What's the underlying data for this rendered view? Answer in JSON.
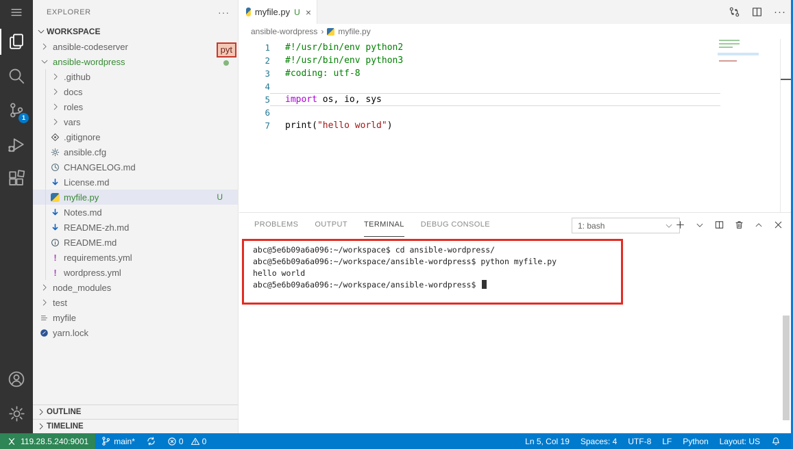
{
  "colors": {
    "accent": "#007acc",
    "remote_green": "#2e8555",
    "git_modified_green": "#388a34",
    "annotation_red": "#e12d24",
    "activity_bar_bg": "#333333",
    "sidebar_bg": "#f3f3f3"
  },
  "activity_bar": {
    "menu_icon": "menu-icon",
    "items": [
      {
        "name": "explorer",
        "icon": "files-icon",
        "active": true
      },
      {
        "name": "search",
        "icon": "search-icon"
      },
      {
        "name": "source-control",
        "icon": "source-control-icon",
        "badge": "1"
      },
      {
        "name": "run-debug",
        "icon": "debug-icon"
      },
      {
        "name": "extensions",
        "icon": "extensions-icon"
      }
    ],
    "bottom_items": [
      {
        "name": "account",
        "icon": "account-icon"
      },
      {
        "name": "settings",
        "icon": "gear-icon"
      }
    ]
  },
  "sidebar": {
    "title": "EXPLORER",
    "more_label": "···",
    "section_label": "WORKSPACE",
    "overlay_badge": {
      "text": "pyt"
    },
    "tree": [
      {
        "label": "ansible-codeserver",
        "level": 1,
        "chevron": "right"
      },
      {
        "label": "ansible-wordpress",
        "level": 1,
        "chevron": "down",
        "git_green": true
      },
      {
        "label": ".github",
        "level": 2,
        "chevron": "right"
      },
      {
        "label": "docs",
        "level": 2,
        "chevron": "right"
      },
      {
        "label": "roles",
        "level": 2,
        "chevron": "right"
      },
      {
        "label": "vars",
        "level": 2,
        "chevron": "right"
      },
      {
        "label": ".gitignore",
        "level": 2,
        "icon": "git-file-icon"
      },
      {
        "label": "ansible.cfg",
        "level": 2,
        "icon": "config-gear-icon"
      },
      {
        "label": "CHANGELOG.md",
        "level": 2,
        "icon": "clock-icon"
      },
      {
        "label": "License.md",
        "level": 2,
        "icon": "markdown-down-icon"
      },
      {
        "label": "myfile.py",
        "level": 2,
        "icon": "python-icon",
        "selected": true,
        "git_green": true,
        "badge": "U"
      },
      {
        "label": "Notes.md",
        "level": 2,
        "icon": "markdown-down-icon"
      },
      {
        "label": "README-zh.md",
        "level": 2,
        "icon": "markdown-down-icon"
      },
      {
        "label": "README.md",
        "level": 2,
        "icon": "info-icon"
      },
      {
        "label": "requirements.yml",
        "level": 2,
        "icon": "exclaim-icon"
      },
      {
        "label": "wordpress.yml",
        "level": 2,
        "icon": "exclaim-icon"
      },
      {
        "label": "node_modules",
        "level": 1,
        "chevron": "right"
      },
      {
        "label": "test",
        "level": 1,
        "chevron": "right"
      },
      {
        "label": "myfile",
        "level": 1,
        "icon": "list-icon"
      },
      {
        "label": "yarn.lock",
        "level": 1,
        "icon": "yarn-icon"
      }
    ],
    "bottom_sections": [
      {
        "label": "OUTLINE"
      },
      {
        "label": "TIMELINE"
      }
    ]
  },
  "editor": {
    "tab": {
      "title": "myfile.py",
      "dirty": "U",
      "close": "×"
    },
    "actions_more": "···",
    "breadcrumbs": {
      "folder": "ansible-wordpress",
      "separator": "›",
      "file": "myfile.py"
    },
    "code": {
      "lines": [
        {
          "num": "1",
          "segments": [
            {
              "text": "#!/usr/bin/env python2",
              "style": "comment"
            }
          ]
        },
        {
          "num": "2",
          "segments": [
            {
              "text": "#!/usr/bin/env python3",
              "style": "comment"
            }
          ]
        },
        {
          "num": "3",
          "segments": [
            {
              "text": "#coding: utf-8",
              "style": "comment"
            }
          ]
        },
        {
          "num": "4",
          "segments": []
        },
        {
          "num": "5",
          "current": true,
          "segments": [
            {
              "text": "import",
              "style": "keyword"
            },
            {
              "text": " os, io, sys",
              "style": "plain"
            }
          ]
        },
        {
          "num": "6",
          "segments": []
        },
        {
          "num": "7",
          "segments": [
            {
              "text": "print(",
              "style": "plain"
            },
            {
              "text": "\"hello world\"",
              "style": "string"
            },
            {
              "text": ")",
              "style": "plain"
            }
          ]
        }
      ]
    }
  },
  "panel": {
    "tabs": [
      {
        "label": "PROBLEMS"
      },
      {
        "label": "OUTPUT"
      },
      {
        "label": "TERMINAL",
        "active": true
      },
      {
        "label": "DEBUG CONSOLE"
      }
    ],
    "terminal_selector": {
      "value": "1: bash"
    },
    "terminal": {
      "lines": [
        "abc@5e6b09a6a096:~/workspace$ cd ansible-wordpress/",
        "abc@5e6b09a6a096:~/workspace/ansible-wordpress$ python myfile.py",
        "hello world",
        "abc@5e6b09a6a096:~/workspace/ansible-wordpress$ "
      ],
      "cursor": "█"
    }
  },
  "status_bar": {
    "remote": {
      "label": "119.28.5.240:9001"
    },
    "branch": {
      "label": "main*"
    },
    "problems": {
      "errors": "0",
      "warnings": "0"
    },
    "right": [
      "Ln 5, Col 19",
      "Spaces: 4",
      "UTF-8",
      "LF",
      "Python",
      "Layout: US"
    ]
  }
}
